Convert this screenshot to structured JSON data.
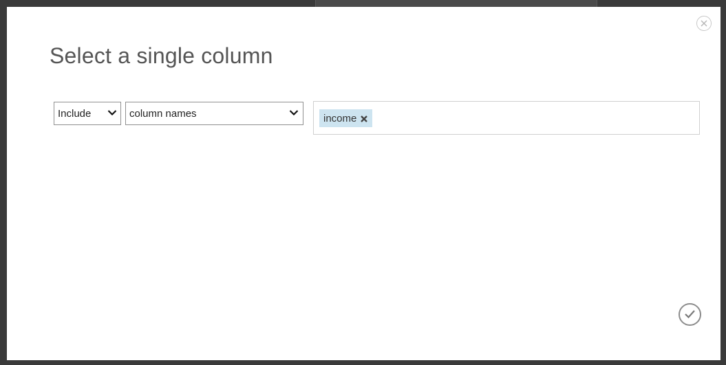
{
  "dialog": {
    "title": "Select a single column",
    "close_icon": "close-icon",
    "ok_icon": "checkmark-icon"
  },
  "rule": {
    "mode": "Include",
    "mode_options_visible": [
      "Include"
    ],
    "selector": "column names",
    "tags": [
      {
        "label": "income",
        "remove_icon": "remove-x-icon"
      }
    ]
  },
  "colors": {
    "tag_background": "#cde4f0",
    "frame": "#3a3a3a",
    "title_text": "#555555"
  }
}
